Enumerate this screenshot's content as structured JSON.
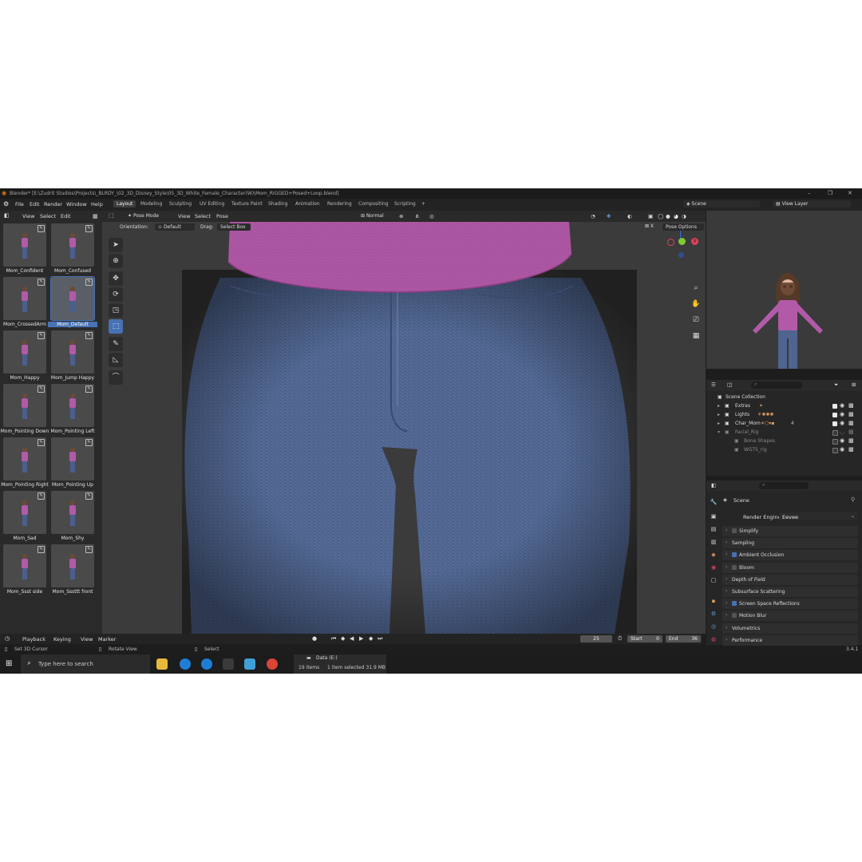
{
  "window": {
    "title": "Blender* [E:\\Zudrit Studios\\Projects\\_BLRDY_\\02_3D_Disney_Style\\05_3D_White_Female_Character(W)\\Mom_RIGGED+Posed+Loop.blend]"
  },
  "menu": [
    "File",
    "Edit",
    "Render",
    "Window",
    "Help"
  ],
  "workspaces": [
    "Layout",
    "Modeling",
    "Sculpting",
    "UV Editing",
    "Texture Paint",
    "Shading",
    "Animation",
    "Rendering",
    "Compositing",
    "Scripting",
    "+"
  ],
  "scene_selector": "Scene",
  "view_layer": "View Layer",
  "asset_browser": {
    "menu": [
      "View",
      "Select",
      "Edit"
    ],
    "items": [
      {
        "label": "Mom_Confident",
        "selected": false
      },
      {
        "label": "Mom_Confused",
        "selected": false
      },
      {
        "label": "Mom_CrossedArm",
        "selected": false
      },
      {
        "label": "Mom_Default",
        "selected": true
      },
      {
        "label": "Mom_Happy",
        "selected": false
      },
      {
        "label": "Mom_Jump Happy",
        "selected": false
      },
      {
        "label": "Mom_Pointing Down",
        "selected": false
      },
      {
        "label": "Mom_Pointing Left",
        "selected": false
      },
      {
        "label": "Mom_Pointing Right",
        "selected": false
      },
      {
        "label": "Mom_Pointing Up",
        "selected": false
      },
      {
        "label": "Mom_Sad",
        "selected": false
      },
      {
        "label": "Mom_Shy",
        "selected": false
      },
      {
        "label": "Mom_Ssst side",
        "selected": false
      },
      {
        "label": "Mom_Sssttt front",
        "selected": false
      }
    ]
  },
  "viewport_header": {
    "mode": "Pose Mode",
    "menu": [
      "View",
      "Select",
      "Pose"
    ],
    "transform": "Normal",
    "orientation_label": "Orientation:",
    "orientation": "Default",
    "drag_label": "Drag:",
    "drag": "Select Box",
    "pose_options": "Pose Options"
  },
  "outliner": {
    "root": "Scene Collection",
    "rows": [
      {
        "label": "Extras"
      },
      {
        "label": "Lights"
      },
      {
        "label": "Char_Mom"
      },
      {
        "label": "Facial_Rig"
      },
      {
        "label": "Bone Shapes"
      },
      {
        "label": "WGTS_rig"
      }
    ],
    "char_count": "4"
  },
  "properties": {
    "tab": "Scene",
    "render_engine_label": "Render Engine",
    "render_engine": "Eevee",
    "sections": [
      {
        "label": "Simplify",
        "checkbox": true,
        "checked": false
      },
      {
        "label": "Sampling",
        "checkbox": false,
        "checked": false
      },
      {
        "label": "Ambient Occlusion",
        "checkbox": true,
        "checked": true
      },
      {
        "label": "Bloom",
        "checkbox": true,
        "checked": false
      },
      {
        "label": "Depth of Field",
        "checkbox": false,
        "checked": false
      },
      {
        "label": "Subsurface Scattering",
        "checkbox": false,
        "checked": false
      },
      {
        "label": "Screen Space Reflections",
        "checkbox": true,
        "checked": true
      },
      {
        "label": "Motion Blur",
        "checkbox": true,
        "checked": false
      },
      {
        "label": "Volumetrics",
        "checkbox": false,
        "checked": false
      },
      {
        "label": "Performance",
        "checkbox": false,
        "checked": false
      }
    ]
  },
  "timeline": {
    "menu": [
      "Playback",
      "Keying",
      "View",
      "Marker"
    ],
    "current_frame": "25",
    "start_label": "Start",
    "start": "0",
    "end_label": "End",
    "end": "36"
  },
  "statusbar": {
    "left": "Set 3D Cursor",
    "middle": "Rotate View",
    "right": "Select",
    "version": "3.4.1"
  },
  "taskbar": {
    "search_placeholder": "Type here to search",
    "explorer_path": "Data (E:)",
    "explorer_items": "19 items",
    "explorer_selected": "1 item selected  31.9 MB"
  },
  "colors": {
    "accent": "#4772b3",
    "sweater": "#b25aa8",
    "denim": "#4f6590",
    "viewport_bg": "#3b3b3b"
  }
}
